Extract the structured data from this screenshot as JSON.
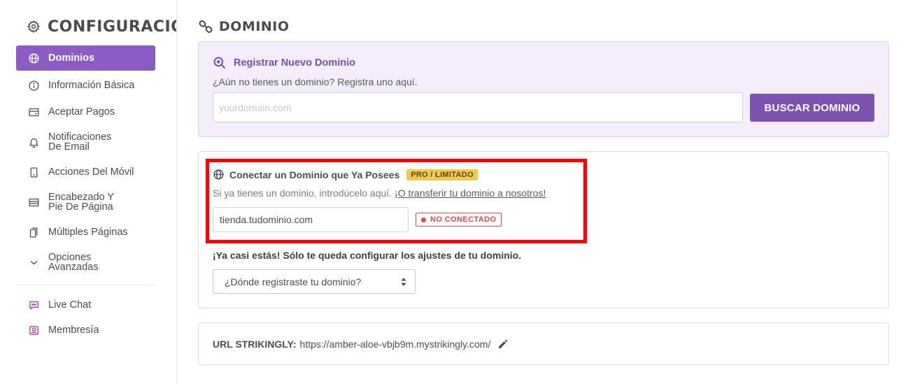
{
  "sidebar": {
    "title": "CONFIGURACIÓN",
    "title_icon": "gear-icon",
    "items": [
      {
        "label": "Dominios",
        "icon": "globe-icon",
        "active": true
      },
      {
        "label": "Información Básica",
        "icon": "info-icon"
      },
      {
        "label": "Aceptar Pagos",
        "icon": "card-icon"
      },
      {
        "label": "Notificaciones De Email",
        "icon": "bell-icon"
      },
      {
        "label": "Acciones Del Móvil",
        "icon": "mobile-icon"
      },
      {
        "label": "Encabezado Y Pie De Página",
        "icon": "layout-icon"
      },
      {
        "label": "Múltiples Páginas",
        "icon": "pages-icon"
      },
      {
        "label": "Opciones Avanzadas",
        "icon": "chevron-down-icon"
      },
      {
        "label": "Live Chat",
        "icon": "chat-icon"
      },
      {
        "label": "Membresía",
        "icon": "member-icon"
      }
    ]
  },
  "main": {
    "title": "DOMINIO",
    "title_icon": "link-icon"
  },
  "register": {
    "heading": "Registrar Nuevo Dominio",
    "subtitle": "¿Aún no tienes un dominio? Registra uno aquí.",
    "placeholder": "yourdomain.com",
    "button": "BUSCAR DOMINIO"
  },
  "connect": {
    "heading": "Conectar un Dominio que Ya Posees",
    "badge": "PRO / LIMITADO",
    "subtitle": "Si ya tienes un dominio, introdúcelo aquí.",
    "link": "¡O transferir tu dominio a nosotros!",
    "input_value": "tienda.tudominio.com",
    "status": "NO CONECTADO",
    "almost": "¡Ya casi estás! Sólo te queda configurar los ajustes de tu dominio.",
    "select_value": "¿Dónde registraste tu dominio?"
  },
  "url": {
    "label": "URL STRIKINGLY:",
    "value": "https://amber-aloe-vbjb9m.mystrikingly.com/"
  },
  "colors": {
    "accent": "#8a5cc4",
    "button": "#7b52b0",
    "badge_pro": "#f2c94c",
    "status_red": "#e04848",
    "highlight": "#ff0000"
  }
}
